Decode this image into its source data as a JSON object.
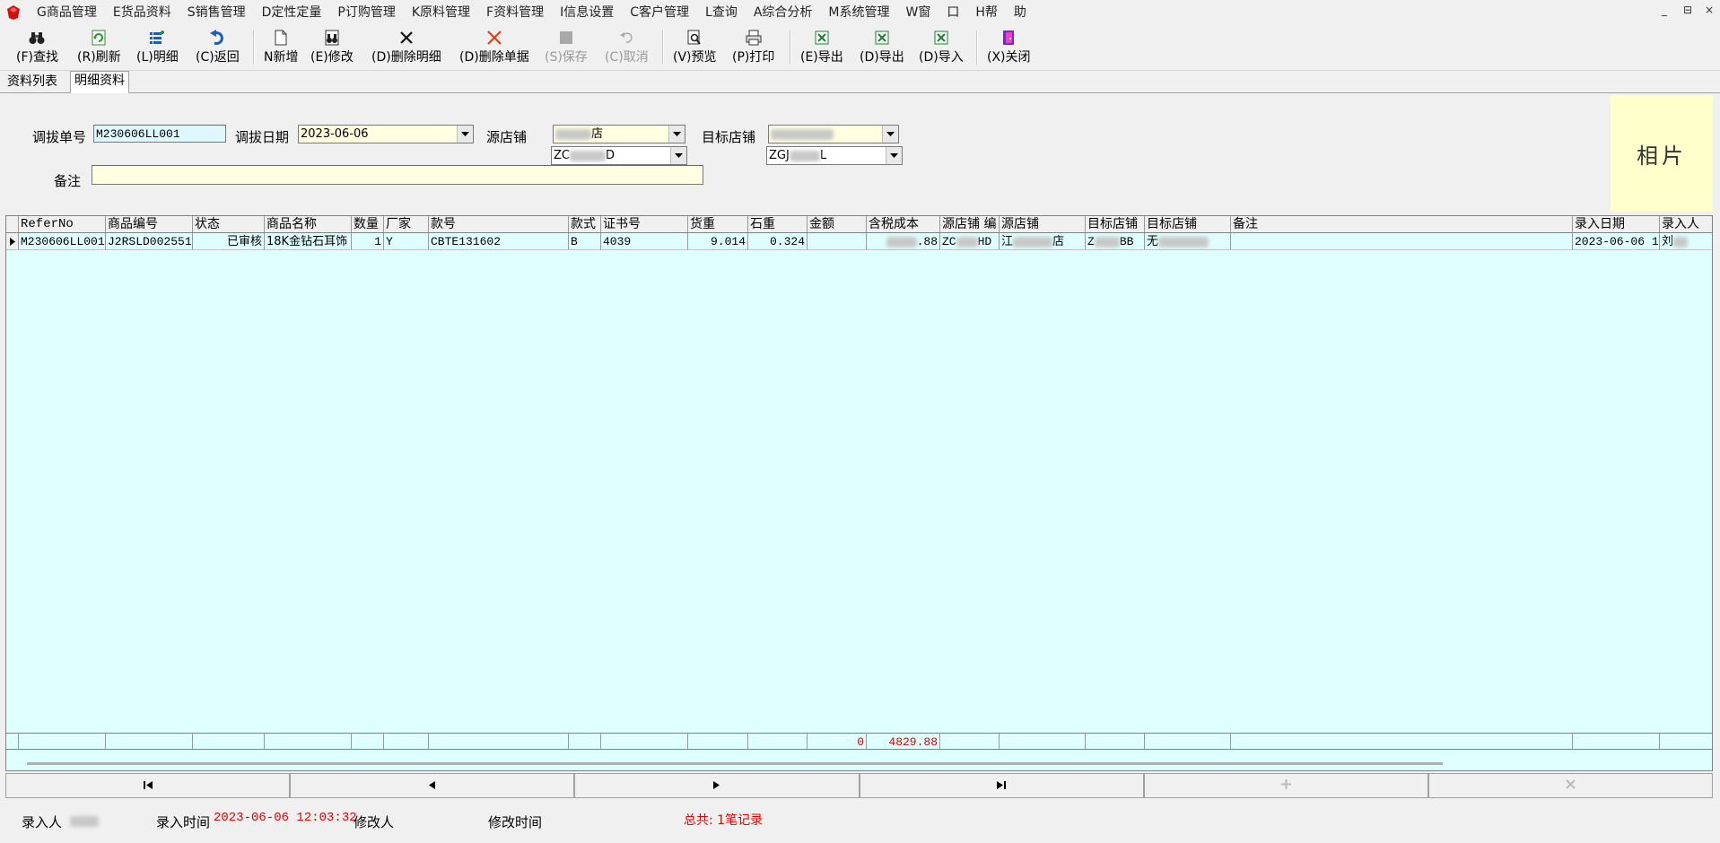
{
  "menu": {
    "items": [
      "G商品管理",
      "E货品资料",
      "S销售管理",
      "D定性定量",
      "P订购管理",
      "K原料管理",
      "F资料管理",
      "I信息设置",
      "C客户管理",
      "L查询",
      "A综合分析",
      "M系统管理",
      "W窗",
      "口",
      "H帮",
      "助"
    ],
    "window_controls": [
      "_",
      "⊟",
      "×"
    ]
  },
  "toolbar": {
    "find": "(F)查找",
    "refresh": "(R)刷新",
    "detail": "(L)明细",
    "back": "(C)返回",
    "new": "N新增",
    "edit": "(E)修改",
    "delete_detail": "(D)删除明细",
    "delete_doc": "(D)删除单据",
    "save": "(S)保存",
    "cancel": "(C)取消",
    "preview": "(V)预览",
    "print": "(P)打印",
    "export1": "(E)导出",
    "export2": "(D)导出",
    "import": "(D)导入",
    "close": "(X)关闭"
  },
  "tabs": [
    "资料列表",
    "明细资料"
  ],
  "form": {
    "transfer_no_label": "调拔单号",
    "transfer_no": "M230606LL001",
    "transfer_date_label": "调拔日期",
    "transfer_date": "2023-06-06",
    "source_store_label": "源店铺",
    "source_store_name_suffix": "店",
    "source_store_code_prefix": "ZC",
    "source_store_code_suffix": "D",
    "target_store_label": "目标店铺",
    "target_store_code_prefix": "ZGJ",
    "target_store_code_suffix": "L",
    "remark_label": "备注",
    "remark": "",
    "photo_label": "相片"
  },
  "grid": {
    "columns": [
      "ReferNo",
      "商品编号",
      "状态",
      "商品名称",
      "数量",
      "厂家",
      "款号",
      "款式",
      "证书号",
      "货重",
      "石重",
      "金额",
      "含税成本",
      "源店铺 编",
      "源店铺",
      "目标店铺",
      "目标店铺",
      "备注",
      "录入日期",
      "录入人"
    ],
    "rows": [
      {
        "refer_no": "M230606LL001",
        "product_no": "J2RSLD002551",
        "status": "已审核",
        "product_name": "18K金钻石耳饰",
        "qty": "1",
        "vendor": "Y",
        "style_no": "CBTE131602",
        "style": "B",
        "cert_no": "4039",
        "gold_weight": "9.014",
        "stone_weight": "0.324",
        "amount": "",
        "cost_suffix": ".88",
        "source_code_prefix": "ZC",
        "source_code_suffix": "HD",
        "source_name_prefix": "江",
        "source_name_suffix": "店",
        "target_code_prefix": "Z",
        "target_code_suffix": "BB",
        "target_name_prefix": "无",
        "remark": "",
        "entry_date": "2023-06-06 1:",
        "entry_user_prefix": "刘"
      }
    ],
    "summary": {
      "amount": "0",
      "cost": "4829.88"
    }
  },
  "navigator": [
    "first",
    "prev",
    "next",
    "last",
    "refresh",
    "cancel"
  ],
  "status": {
    "entry_user_label": "录入人",
    "entry_time_label": "录入时间",
    "entry_time": "2023-06-06 12:03:32",
    "modifier_label": "修改人",
    "modify_time_label": "修改时间",
    "total": "总共: 1笔记录"
  },
  "colors": {
    "grid_bg": "#dfffff",
    "input_bg": "#ffffe1",
    "photo_bg": "#ffffcc",
    "accent_red": "#e00000"
  }
}
